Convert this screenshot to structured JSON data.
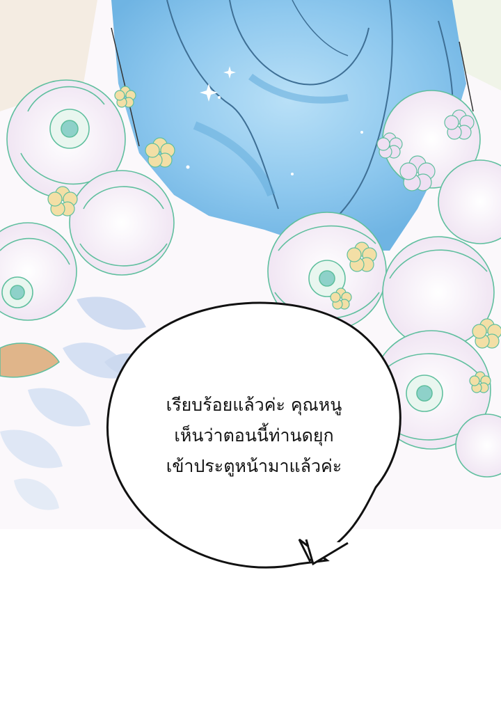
{
  "speech_bubble": {
    "lines": [
      "เรียบร้อยแล้วค่ะ คุณหนู",
      "เห็นว่าตอนนี้ท่านดยุก",
      "เข้าประตูหน้ามาแล้วค่ะ"
    ]
  },
  "colors": {
    "background": "#ffffff",
    "dress_blue": "#8ec8ee",
    "dress_shadow": "#5aa6d8",
    "flower_petal": "#f6eef7",
    "flower_outline": "#5fbf9e",
    "blossom_yellow": "#f3dfa6",
    "leaf_blue": "#c9d8f0",
    "bubble_outline": "#111111"
  }
}
